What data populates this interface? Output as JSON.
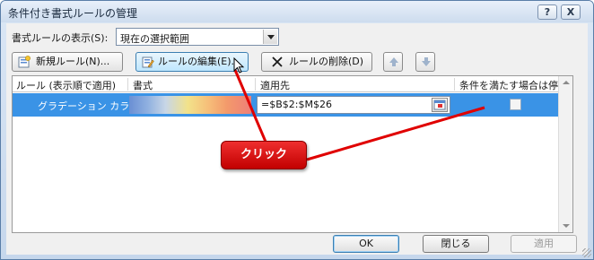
{
  "window": {
    "title": "条件付き書式ルールの管理",
    "help_label": "?",
    "close_label": "X"
  },
  "show_rules": {
    "label": "書式ルールの表示(S):",
    "value": "現在の選択範囲"
  },
  "toolbar": {
    "new_rule": "新規ルール(N)...",
    "edit_rule": "ルールの編集(E)...",
    "delete_rule": "ルールの削除(D)",
    "move_up_icon": "arrow-up-icon",
    "move_down_icon": "arrow-down-icon"
  },
  "table": {
    "columns": [
      "ルール (表示順で適用)",
      "書式",
      "適用先",
      "条件を満たす場合は停止"
    ],
    "rows": [
      {
        "rule": "グラデーション カラ...",
        "format": "color-scale-preview",
        "applies_to": "=$B$2:$M$26",
        "stop_if_true": false
      }
    ]
  },
  "footer": {
    "ok": "OK",
    "close": "閉じる",
    "apply": "適用"
  },
  "annotation": {
    "label": "クリック",
    "color": "#d40000"
  },
  "colors": {
    "selection": "#3a93e6",
    "gradient": [
      "#6a8fd4",
      "#c8d6e6",
      "#f2e28a",
      "#f6c07a",
      "#ee7e78"
    ]
  }
}
